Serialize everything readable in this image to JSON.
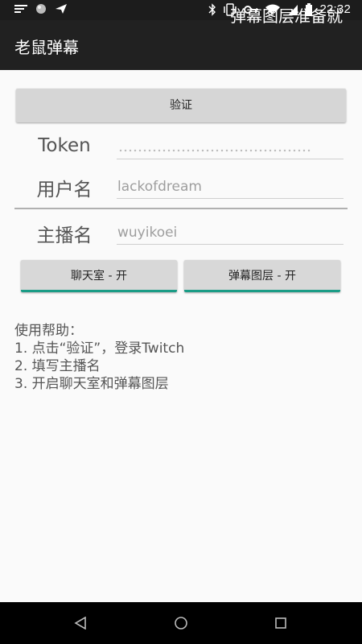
{
  "status_bar": {
    "time": "22:32",
    "icons": [
      "menu-icon",
      "circle-icon",
      "send-icon",
      "bluetooth-icon",
      "vibrate-icon",
      "key-icon",
      "wifi-icon",
      "signal-icon",
      "battery-icon"
    ]
  },
  "app_bar": {
    "title": "老鼠弹幕",
    "overlay_text": "弹幕图层准备就"
  },
  "form": {
    "verify_button": "验证",
    "token_label": "Token",
    "username_label": "用户名",
    "username_value": "lackofdream",
    "streamer_label": "主播名",
    "streamer_value": "wuyikoei"
  },
  "toggles": {
    "chat_room": "聊天室 - 开",
    "danmaku_layer": "弹幕图层 - 开"
  },
  "help": {
    "title": "使用帮助：",
    "lines": [
      "1. 点击“验证”，登录Twitch",
      "2. 填写主播名",
      "3. 开启聊天室和弹幕图层"
    ]
  },
  "nav_bar": {
    "icons": [
      "back-icon",
      "home-icon",
      "recents-icon"
    ]
  },
  "colors": {
    "status_bar": "#1c1c1c",
    "app_bar": "#212121",
    "accent": "#1a9c86",
    "background": "#fafafa"
  }
}
